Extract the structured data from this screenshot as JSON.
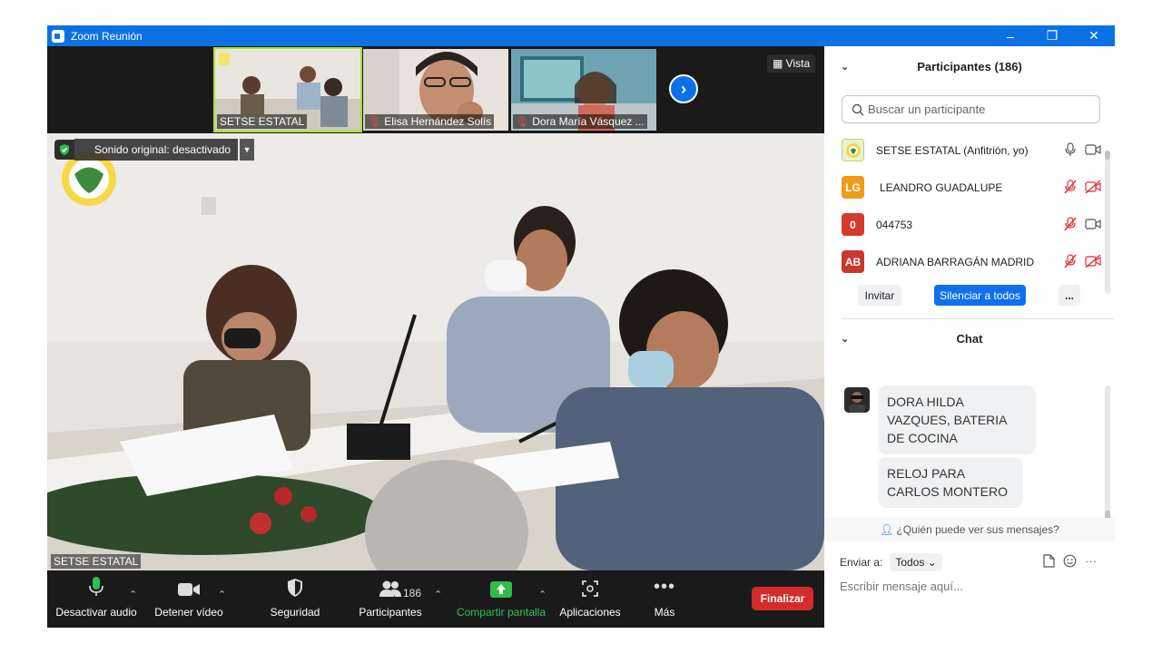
{
  "window": {
    "title": "Zoom Reunión",
    "minimize": "–",
    "restore": "❐",
    "close": "✕"
  },
  "filmstrip": {
    "thumbnails": [
      {
        "label": "SETSE ESTATAL",
        "muted": false
      },
      {
        "label": "Elisa Hernández Solís",
        "muted": true
      },
      {
        "label": "Dora María Vásquez ...",
        "muted": true
      }
    ],
    "next_arrow": "›",
    "view_label": "Vista"
  },
  "main_video": {
    "sound_label": "Sonido original: desactivado",
    "speaker_name": "SETSE ESTATAL"
  },
  "toolbar": {
    "audio": "Desactivar audio",
    "video": "Detener vídeo",
    "security": "Seguridad",
    "participants": "Participantes",
    "participant_count": "186",
    "share": "Compartir pantalla",
    "apps": "Aplicaciones",
    "more": "Más",
    "end": "Finalizar"
  },
  "participants_panel": {
    "title": "Participantes (186)",
    "search_placeholder": "Buscar un participante",
    "items": [
      {
        "initials": "",
        "name": "SETSE ESTATAL (Anfitrión, yo)",
        "avatar_color": "#e8f1d0",
        "mic_muted": false,
        "video_off": false
      },
      {
        "initials": "LG",
        "name": "LEANDRO GUADALUPE",
        "avatar_color": "#f09a1a",
        "mic_muted": true,
        "video_off": true
      },
      {
        "initials": "0",
        "name": "044753",
        "avatar_color": "#d63a2b",
        "mic_muted": true,
        "video_off": false
      },
      {
        "initials": "AB",
        "name": "ADRIANA BARRAGÁN MADRID",
        "avatar_color": "#c8382c",
        "mic_muted": true,
        "video_off": true
      }
    ],
    "invite": "Invitar",
    "mute_all": "Silenciar a todos",
    "more": "..."
  },
  "chat_panel": {
    "title": "Chat",
    "messages": [
      {
        "text": "DORA HILDA VAZQUES, BATERIA DE COCINA"
      },
      {
        "text": "RELOJ PARA CARLOS MONTERO"
      }
    ],
    "who_can_see": "¿Quién puede ver sus mensajes?",
    "send_to_label": "Enviar a:",
    "send_to_value": "Todos",
    "input_placeholder": "Escribir mensaje aquí..."
  }
}
